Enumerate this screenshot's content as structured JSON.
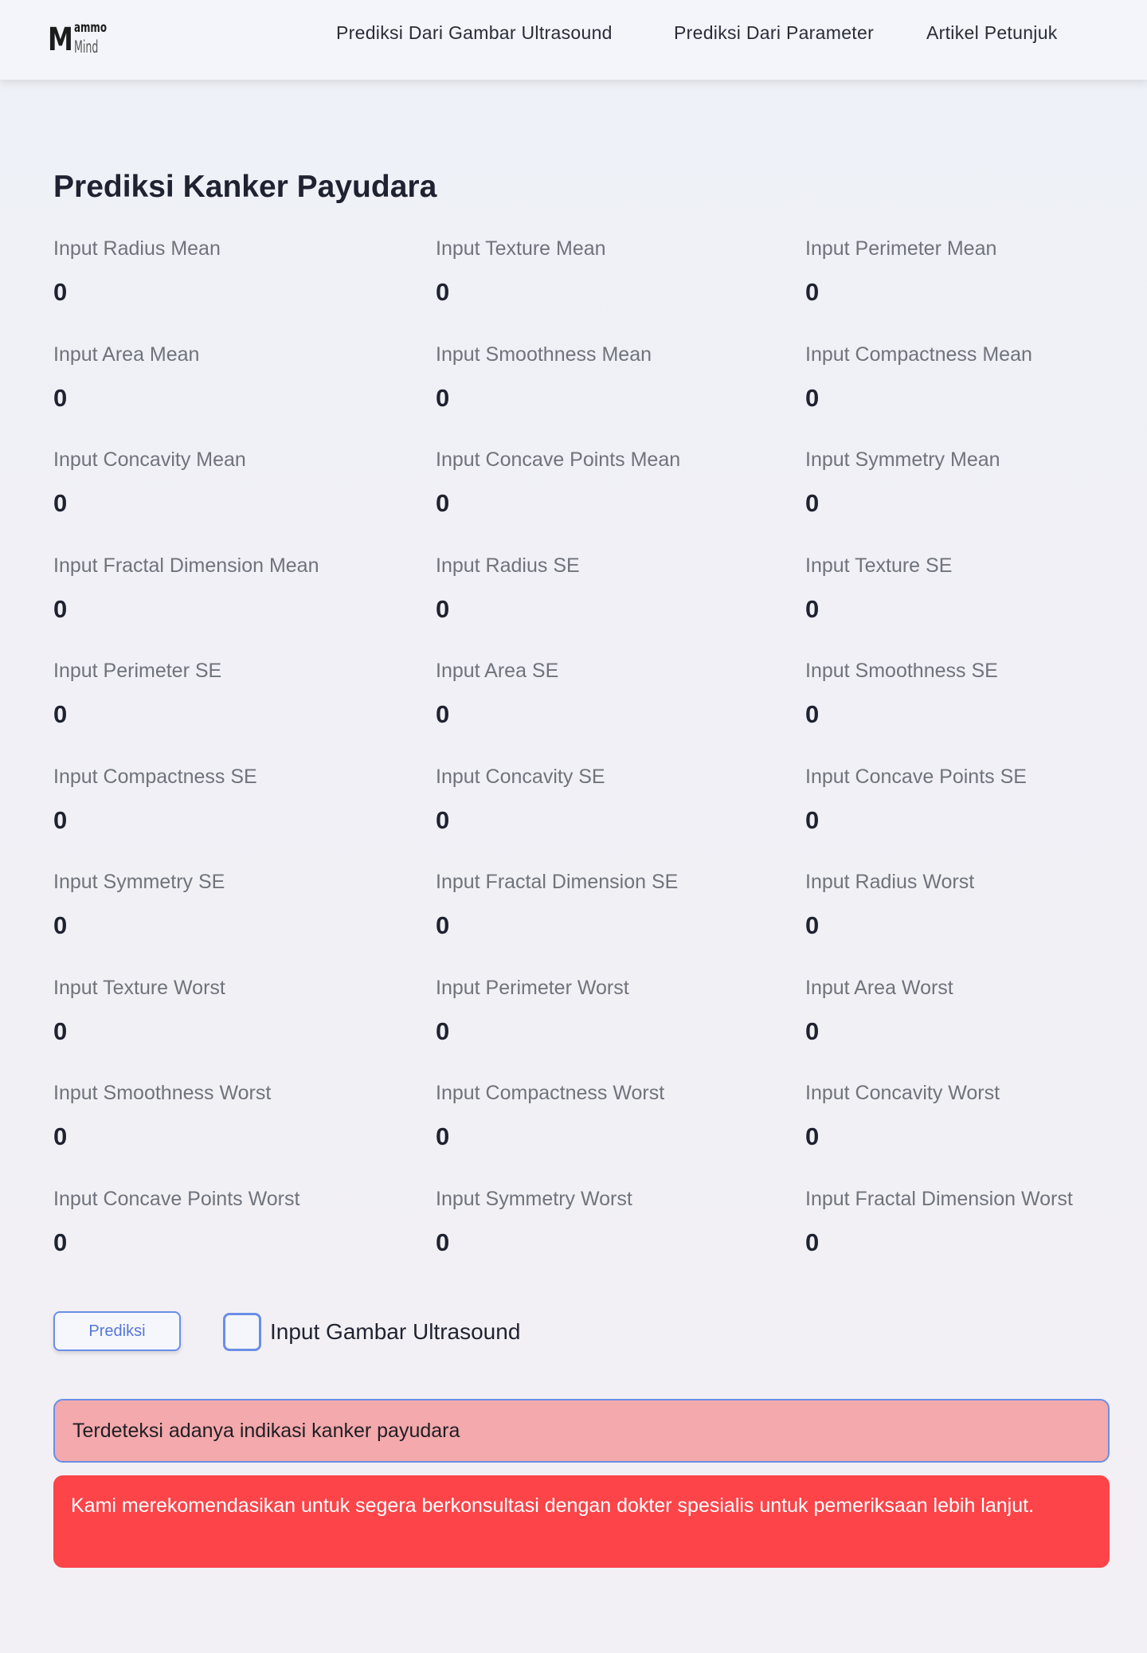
{
  "brand": {
    "logo_big": "M",
    "logo_top": "ammo",
    "logo_bottom": "Mind"
  },
  "nav": {
    "items": [
      {
        "label": "Prediksi Dari Gambar Ultrasound"
      },
      {
        "label": "Prediksi Dari Parameter"
      },
      {
        "label": "Artikel Petunjuk"
      }
    ]
  },
  "page_title": "Prediksi Kanker Payudara",
  "fields": [
    {
      "label": "Input Radius Mean",
      "value": "0"
    },
    {
      "label": "Input Texture Mean",
      "value": "0"
    },
    {
      "label": "Input Perimeter Mean",
      "value": "0"
    },
    {
      "label": "Input Area Mean",
      "value": "0"
    },
    {
      "label": "Input Smoothness Mean",
      "value": "0"
    },
    {
      "label": "Input Compactness Mean",
      "value": "0"
    },
    {
      "label": "Input Concavity Mean",
      "value": "0"
    },
    {
      "label": "Input Concave Points Mean",
      "value": "0"
    },
    {
      "label": "Input Symmetry Mean",
      "value": "0"
    },
    {
      "label": "Input Fractal Dimension Mean",
      "value": "0"
    },
    {
      "label": "Input  Radius SE",
      "value": "0"
    },
    {
      "label": "Input Texture SE",
      "value": "0"
    },
    {
      "label": "Input Perimeter SE",
      "value": "0"
    },
    {
      "label": "Input Area SE",
      "value": "0"
    },
    {
      "label": "Input Smoothness SE",
      "value": "0"
    },
    {
      "label": "Input Compactness SE",
      "value": "0"
    },
    {
      "label": "Input Concavity SE",
      "value": "0"
    },
    {
      "label": "Input Concave Points SE",
      "value": "0"
    },
    {
      "label": "Input Symmetry SE",
      "value": "0"
    },
    {
      "label": "Input Fractal Dimension SE",
      "value": "0"
    },
    {
      "label": "Input Radius Worst",
      "value": "0"
    },
    {
      "label": "Input Texture Worst",
      "value": "0"
    },
    {
      "label": "Input Perimeter Worst",
      "value": "0"
    },
    {
      "label": "Input Area Worst",
      "value": "0"
    },
    {
      "label": "Input Smoothness Worst",
      "value": "0"
    },
    {
      "label": "Input Compactness Worst",
      "value": "0"
    },
    {
      "label": "Input Concavity Worst",
      "value": "0"
    },
    {
      "label": "Input Concave Points Worst",
      "value": "0"
    },
    {
      "label": "Input Symmetry Worst",
      "value": "0"
    },
    {
      "label": "Input Fractal Dimension Worst",
      "value": "0"
    }
  ],
  "actions": {
    "predict_label": "Prediksi",
    "checkbox_label": "Input Gambar Ultrasound",
    "checkbox_checked": false
  },
  "result": {
    "detection_text": "Terdeteksi adanya indikasi kanker payudara",
    "recommendation_text": "Kami merekomendasikan untuk segera berkonsultasi dengan dokter spesialis untuk pemeriksaan lebih lanjut."
  },
  "colors": {
    "accent": "#6b8ee6",
    "alert_pink": "#f4a9ac",
    "alert_red": "#fc4449"
  }
}
